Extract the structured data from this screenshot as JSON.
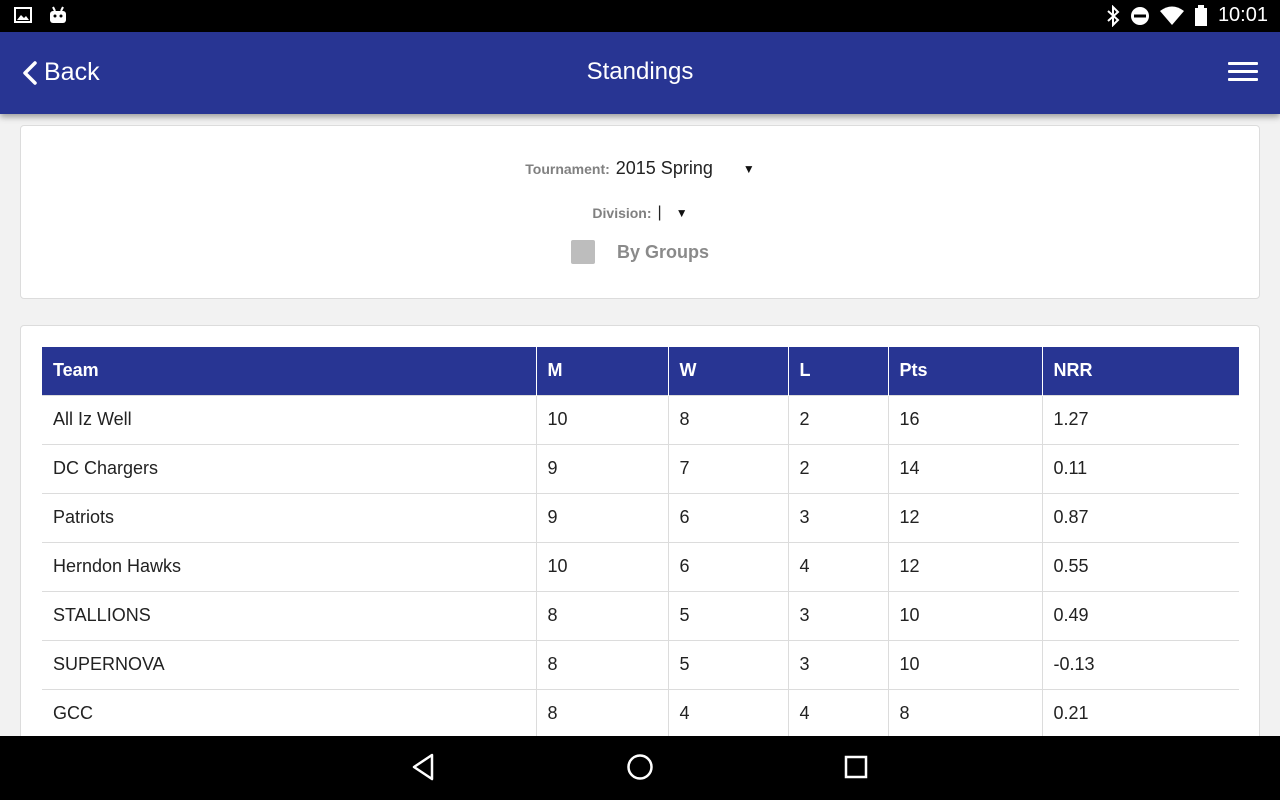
{
  "status_bar": {
    "time": "10:01",
    "icons": [
      "image-icon",
      "android-icon",
      "bluetooth-icon",
      "do-not-disturb-icon",
      "wifi-icon",
      "battery-icon"
    ]
  },
  "app_bar": {
    "back_label": "Back",
    "title": "Standings",
    "menu_icon": "menu-icon"
  },
  "filters": {
    "tournament_label": "Tournament:",
    "tournament_value": "2015 Spring",
    "division_label": "Division:",
    "division_value": "|",
    "by_groups_label": "By Groups",
    "by_groups_checked": false
  },
  "table": {
    "headers": [
      "Team",
      "M",
      "W",
      "L",
      "Pts",
      "NRR"
    ],
    "rows": [
      [
        "All Iz Well",
        "10",
        "8",
        "2",
        "16",
        "1.27"
      ],
      [
        "DC Chargers",
        "9",
        "7",
        "2",
        "14",
        "0.11"
      ],
      [
        "Patriots",
        "9",
        "6",
        "3",
        "12",
        "0.87"
      ],
      [
        "Herndon Hawks",
        "10",
        "6",
        "4",
        "12",
        "0.55"
      ],
      [
        "STALLIONS",
        "8",
        "5",
        "3",
        "10",
        "0.49"
      ],
      [
        "SUPERNOVA",
        "8",
        "5",
        "3",
        "10",
        "-0.13"
      ],
      [
        "GCC",
        "8",
        "4",
        "4",
        "8",
        "0.21"
      ]
    ]
  },
  "colors": {
    "primary": "#283593",
    "background": "#f2f2f2"
  },
  "nav_bar": {
    "icons": [
      "back-triangle-icon",
      "home-circle-icon",
      "recents-square-icon"
    ]
  }
}
